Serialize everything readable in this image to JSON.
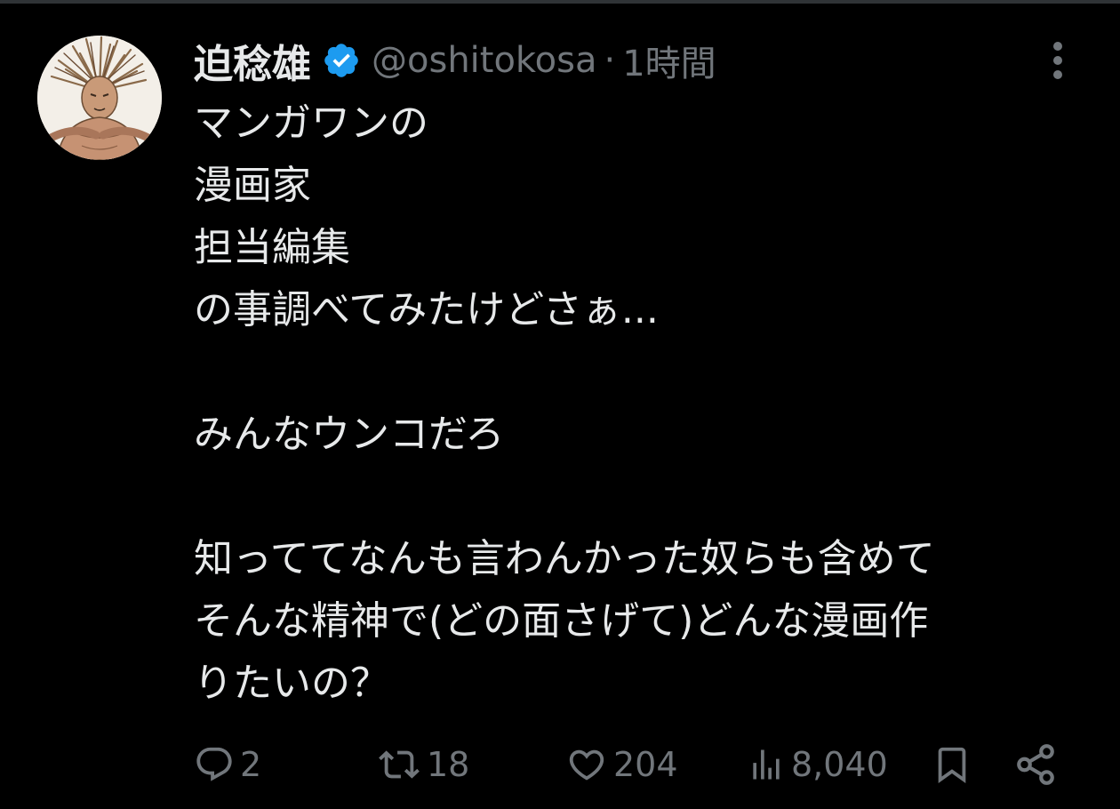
{
  "tweet": {
    "author": {
      "display_name": "迫稔雄",
      "handle": "@oshitokosa",
      "verified": true
    },
    "separator": "·",
    "time": "1時間",
    "text_lines": [
      "マンガワンの",
      "漫画家",
      "担当編集",
      "の事調べてみたけどさぁ...",
      "",
      "みんなウンコだろ",
      "",
      "知っててなんも言わんかった奴らも含めて",
      "そんな精神で(どの面さげて)どんな漫画作",
      "りたいの？"
    ],
    "actions": {
      "replies": "2",
      "reposts": "18",
      "likes": "204",
      "views": "8,040"
    }
  },
  "colors": {
    "background": "#000000",
    "text": "#e7e9ea",
    "secondary": "#71767b",
    "verified_badge": "#1d9bf0"
  },
  "icons": {
    "verified": "verified-badge-icon",
    "more": "more-options-icon",
    "reply": "reply-icon",
    "repost": "repost-icon",
    "like": "like-icon",
    "views": "views-icon",
    "bookmark": "bookmark-icon",
    "share": "share-icon"
  }
}
